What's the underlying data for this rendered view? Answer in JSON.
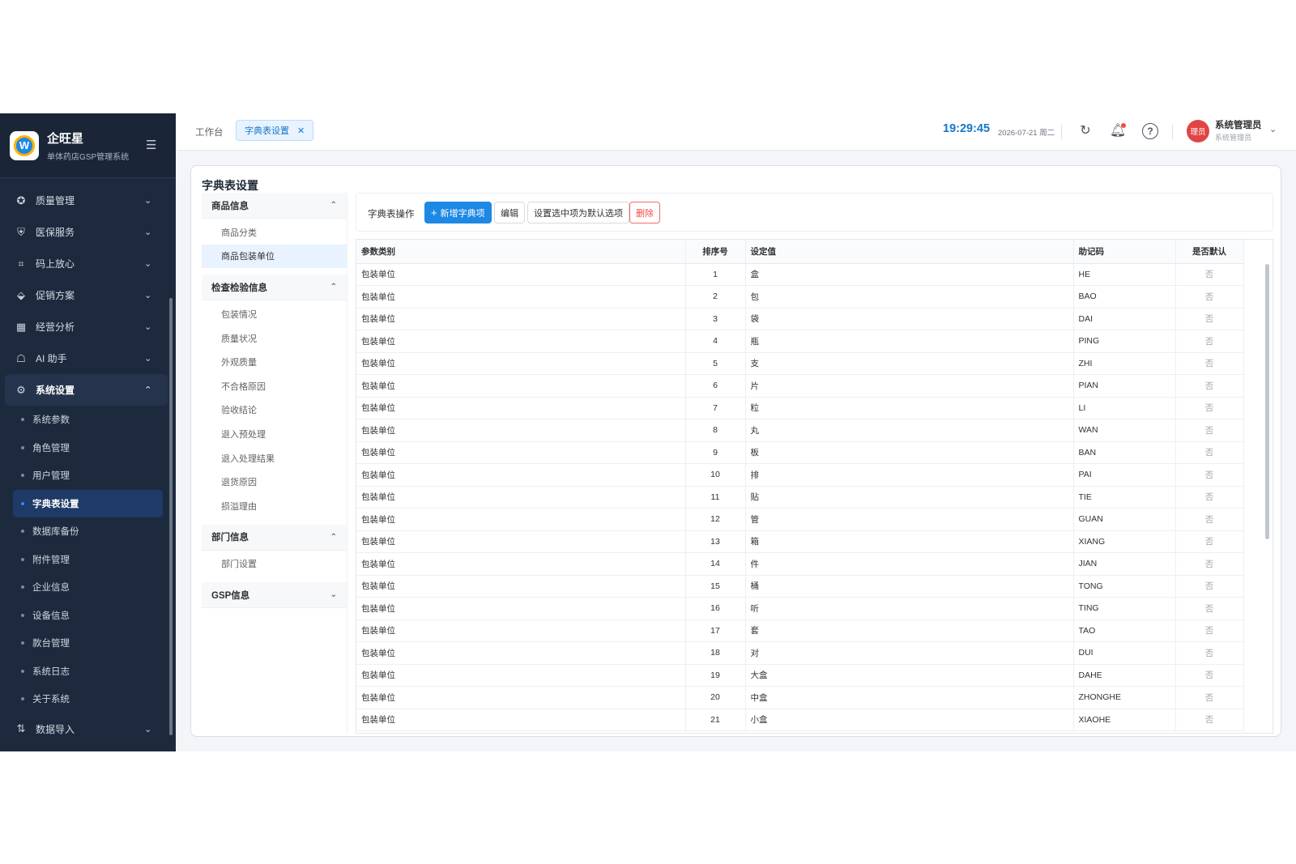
{
  "app": {
    "name": "企旺星",
    "subtitle": "单体药店GSP管理系统",
    "logo_letter": "W"
  },
  "sidebar": {
    "collapse_icon": "menu-fold-icon",
    "menu_before": [
      {
        "label": "质量管理",
        "icon": "check-badge-icon",
        "glyph": "✪"
      },
      {
        "label": "医保服务",
        "icon": "shield-icon",
        "glyph": "⛨"
      },
      {
        "label": "码上放心",
        "icon": "scan-icon",
        "glyph": "⌗"
      },
      {
        "label": "促销方案",
        "icon": "tag-icon",
        "glyph": "⬙"
      },
      {
        "label": "经营分析",
        "icon": "chart-icon",
        "glyph": "▦"
      },
      {
        "label": "AI 助手",
        "icon": "robot-icon",
        "glyph": "☖"
      }
    ],
    "open_menu": {
      "label": "系统设置",
      "icon": "gear-icon",
      "glyph": "⚙"
    },
    "sub_items": [
      {
        "label": "系统参数",
        "active": false
      },
      {
        "label": "角色管理",
        "active": false
      },
      {
        "label": "用户管理",
        "active": false
      },
      {
        "label": "字典表设置",
        "active": true
      },
      {
        "label": "数据库备份",
        "active": false
      },
      {
        "label": "附件管理",
        "active": false
      },
      {
        "label": "企业信息",
        "active": false
      },
      {
        "label": "设备信息",
        "active": false
      },
      {
        "label": "款台管理",
        "active": false
      },
      {
        "label": "系统日志",
        "active": false
      },
      {
        "label": "关于系统",
        "active": false
      }
    ],
    "menu_after": [
      {
        "label": "数据导入",
        "icon": "import-icon",
        "glyph": "⇅"
      }
    ]
  },
  "topbar": {
    "tabs": {
      "home": "工作台",
      "active": "字典表设置"
    },
    "time": "19:29:45",
    "date": "2026-07-21 周二",
    "user": {
      "avatar_text": "理员",
      "name": "系统管理员",
      "role": "系统管理员"
    }
  },
  "page": {
    "title": "字典表设置",
    "categories": [
      {
        "label": "商品信息",
        "expanded": true,
        "items": [
          "商品分类",
          "商品包装单位"
        ]
      },
      {
        "label": "检查检验信息",
        "expanded": true,
        "items": [
          "包装情况",
          "质量状况",
          "外观质量",
          "不合格原因",
          "验收结论",
          "退入预处理",
          "退入处理结果",
          "退货原因",
          "损溢理由"
        ]
      },
      {
        "label": "部门信息",
        "expanded": true,
        "items": [
          "部门设置"
        ]
      },
      {
        "label": "GSP信息",
        "expanded": false,
        "items": []
      }
    ],
    "selected_category_item": "商品包装单位",
    "toolbar": {
      "label": "字典表操作",
      "add": "新增字典项",
      "edit": "编辑",
      "set_default": "设置选中项为默认选项",
      "delete": "删除"
    },
    "table": {
      "columns": [
        "参数类别",
        "排序号",
        "设定值",
        "助记码",
        "是否默认"
      ],
      "rows": [
        [
          "包装单位",
          "1",
          "盒",
          "HE",
          "否"
        ],
        [
          "包装单位",
          "2",
          "包",
          "BAO",
          "否"
        ],
        [
          "包装单位",
          "3",
          "袋",
          "DAI",
          "否"
        ],
        [
          "包装单位",
          "4",
          "瓶",
          "PING",
          "否"
        ],
        [
          "包装单位",
          "5",
          "支",
          "ZHI",
          "否"
        ],
        [
          "包装单位",
          "6",
          "片",
          "PIAN",
          "否"
        ],
        [
          "包装单位",
          "7",
          "粒",
          "LI",
          "否"
        ],
        [
          "包装单位",
          "8",
          "丸",
          "WAN",
          "否"
        ],
        [
          "包装单位",
          "9",
          "板",
          "BAN",
          "否"
        ],
        [
          "包装单位",
          "10",
          "排",
          "PAI",
          "否"
        ],
        [
          "包装单位",
          "11",
          "贴",
          "TIE",
          "否"
        ],
        [
          "包装单位",
          "12",
          "管",
          "GUAN",
          "否"
        ],
        [
          "包装单位",
          "13",
          "箱",
          "XIANG",
          "否"
        ],
        [
          "包装单位",
          "14",
          "件",
          "JIAN",
          "否"
        ],
        [
          "包装单位",
          "15",
          "桶",
          "TONG",
          "否"
        ],
        [
          "包装单位",
          "16",
          "听",
          "TING",
          "否"
        ],
        [
          "包装单位",
          "17",
          "套",
          "TAO",
          "否"
        ],
        [
          "包装单位",
          "18",
          "对",
          "DUI",
          "否"
        ],
        [
          "包装单位",
          "19",
          "大盒",
          "DAHE",
          "否"
        ],
        [
          "包装单位",
          "20",
          "中盒",
          "ZHONGHE",
          "否"
        ],
        [
          "包装单位",
          "21",
          "小盒",
          "XIAOHE",
          "否"
        ]
      ]
    }
  },
  "colors": {
    "sidebar_bg": "#1d2a3e",
    "accent": "#1e88e5",
    "danger": "#f04b4b"
  }
}
